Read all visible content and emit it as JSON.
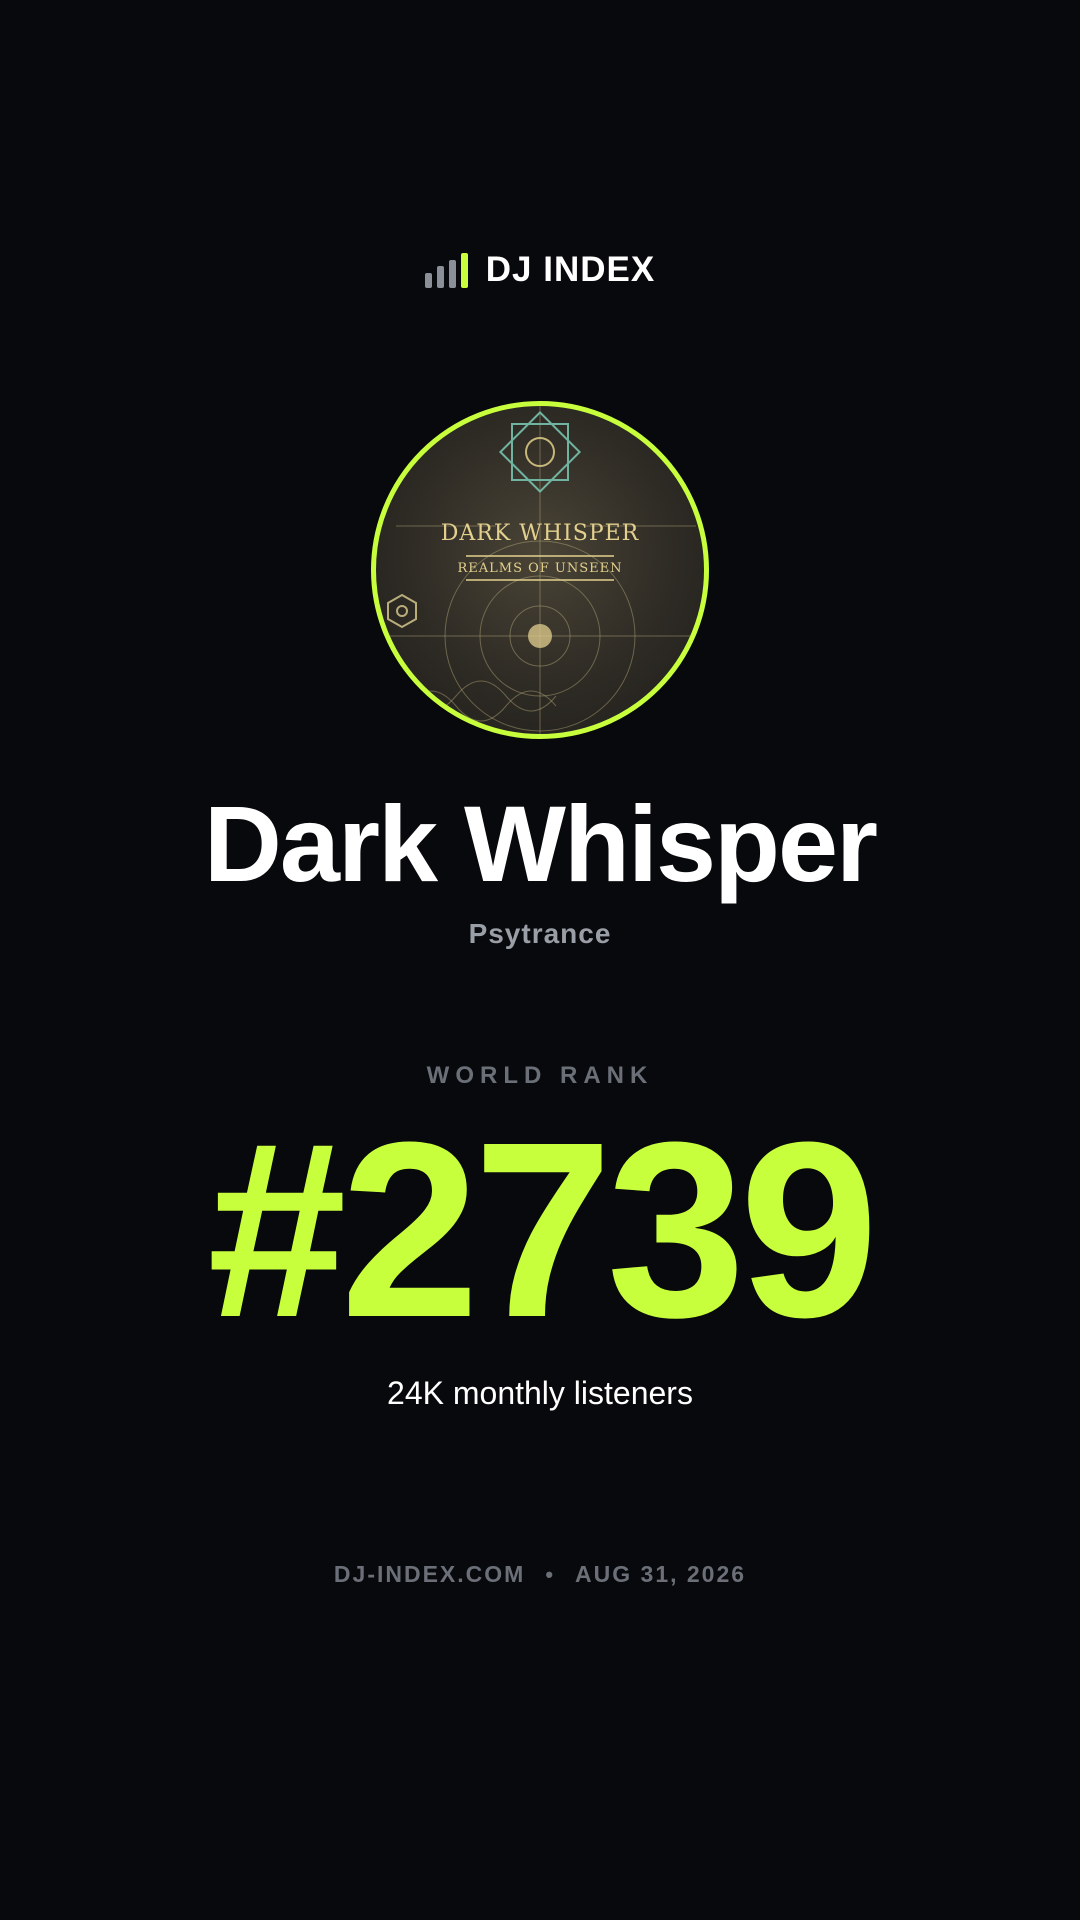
{
  "brand": {
    "name": "DJ INDEX",
    "icon": "bar-chart-icon",
    "accent_color": "#c8ff3c"
  },
  "artist": {
    "name": "Dark Whisper",
    "genre": "Psytrance",
    "avatar": {
      "artwork_title": "DARK WHISPER",
      "artwork_subtitle": "REALMS OF UNSEEN"
    }
  },
  "rank": {
    "label": "WORLD RANK",
    "value": "#2739"
  },
  "stats": {
    "listeners": "24K monthly listeners"
  },
  "footer": {
    "site": "DJ-INDEX.COM",
    "separator": "•",
    "date": "AUG 31, 2026"
  }
}
